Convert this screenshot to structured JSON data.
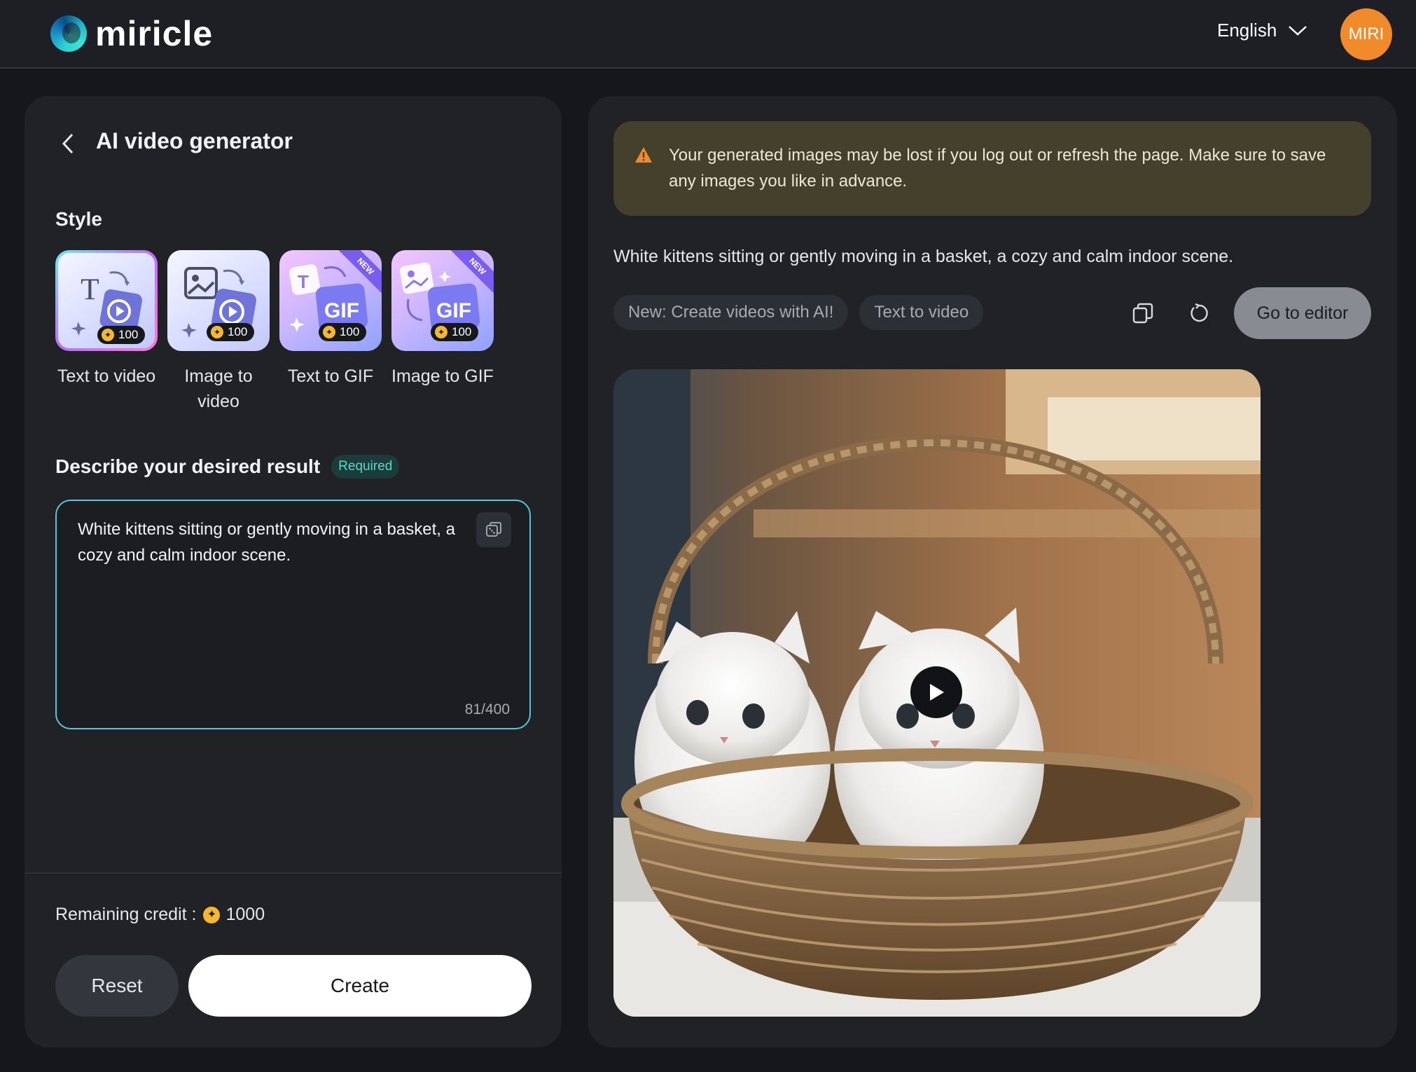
{
  "header": {
    "brand": "miricle",
    "language": "English",
    "avatar_initials": "MIRI"
  },
  "generator": {
    "title": "AI video generator",
    "style_label": "Style",
    "styles": [
      {
        "label": "Text to video",
        "credits": "100",
        "badge": "",
        "selected": true,
        "icon": "text-to-video-icon"
      },
      {
        "label": "Image to video",
        "credits": "100",
        "badge": "",
        "selected": false,
        "icon": "image-to-video-icon"
      },
      {
        "label": "Text to GIF",
        "credits": "100",
        "badge": "NEW",
        "selected": false,
        "icon": "text-to-gif-icon"
      },
      {
        "label": "Image to GIF",
        "credits": "100",
        "badge": "NEW",
        "selected": false,
        "icon": "image-to-gif-icon"
      }
    ],
    "describe_label": "Describe your desired result",
    "required_badge": "Required",
    "prompt_value": "White kittens sitting or gently moving in a basket, a cozy and calm indoor scene.",
    "char_count": "81/400",
    "remaining_credit_label": "Remaining credit :",
    "remaining_credit_value": "1000",
    "reset_label": "Reset",
    "create_label": "Create"
  },
  "result": {
    "warning": "Your generated images may be lost if you log out or refresh the page. Make sure to save any images you like in advance.",
    "prompt": "White kittens sitting or gently moving in a basket, a cozy and calm indoor scene.",
    "tags": [
      "New: Create videos with AI!",
      "Text to video"
    ],
    "editor_label": "Go to editor"
  },
  "colors": {
    "accent_teal": "#52c9d2",
    "avatar_orange": "#f08a2b",
    "warning_bg": "#45402c",
    "coin_gold": "#f5b82e"
  }
}
